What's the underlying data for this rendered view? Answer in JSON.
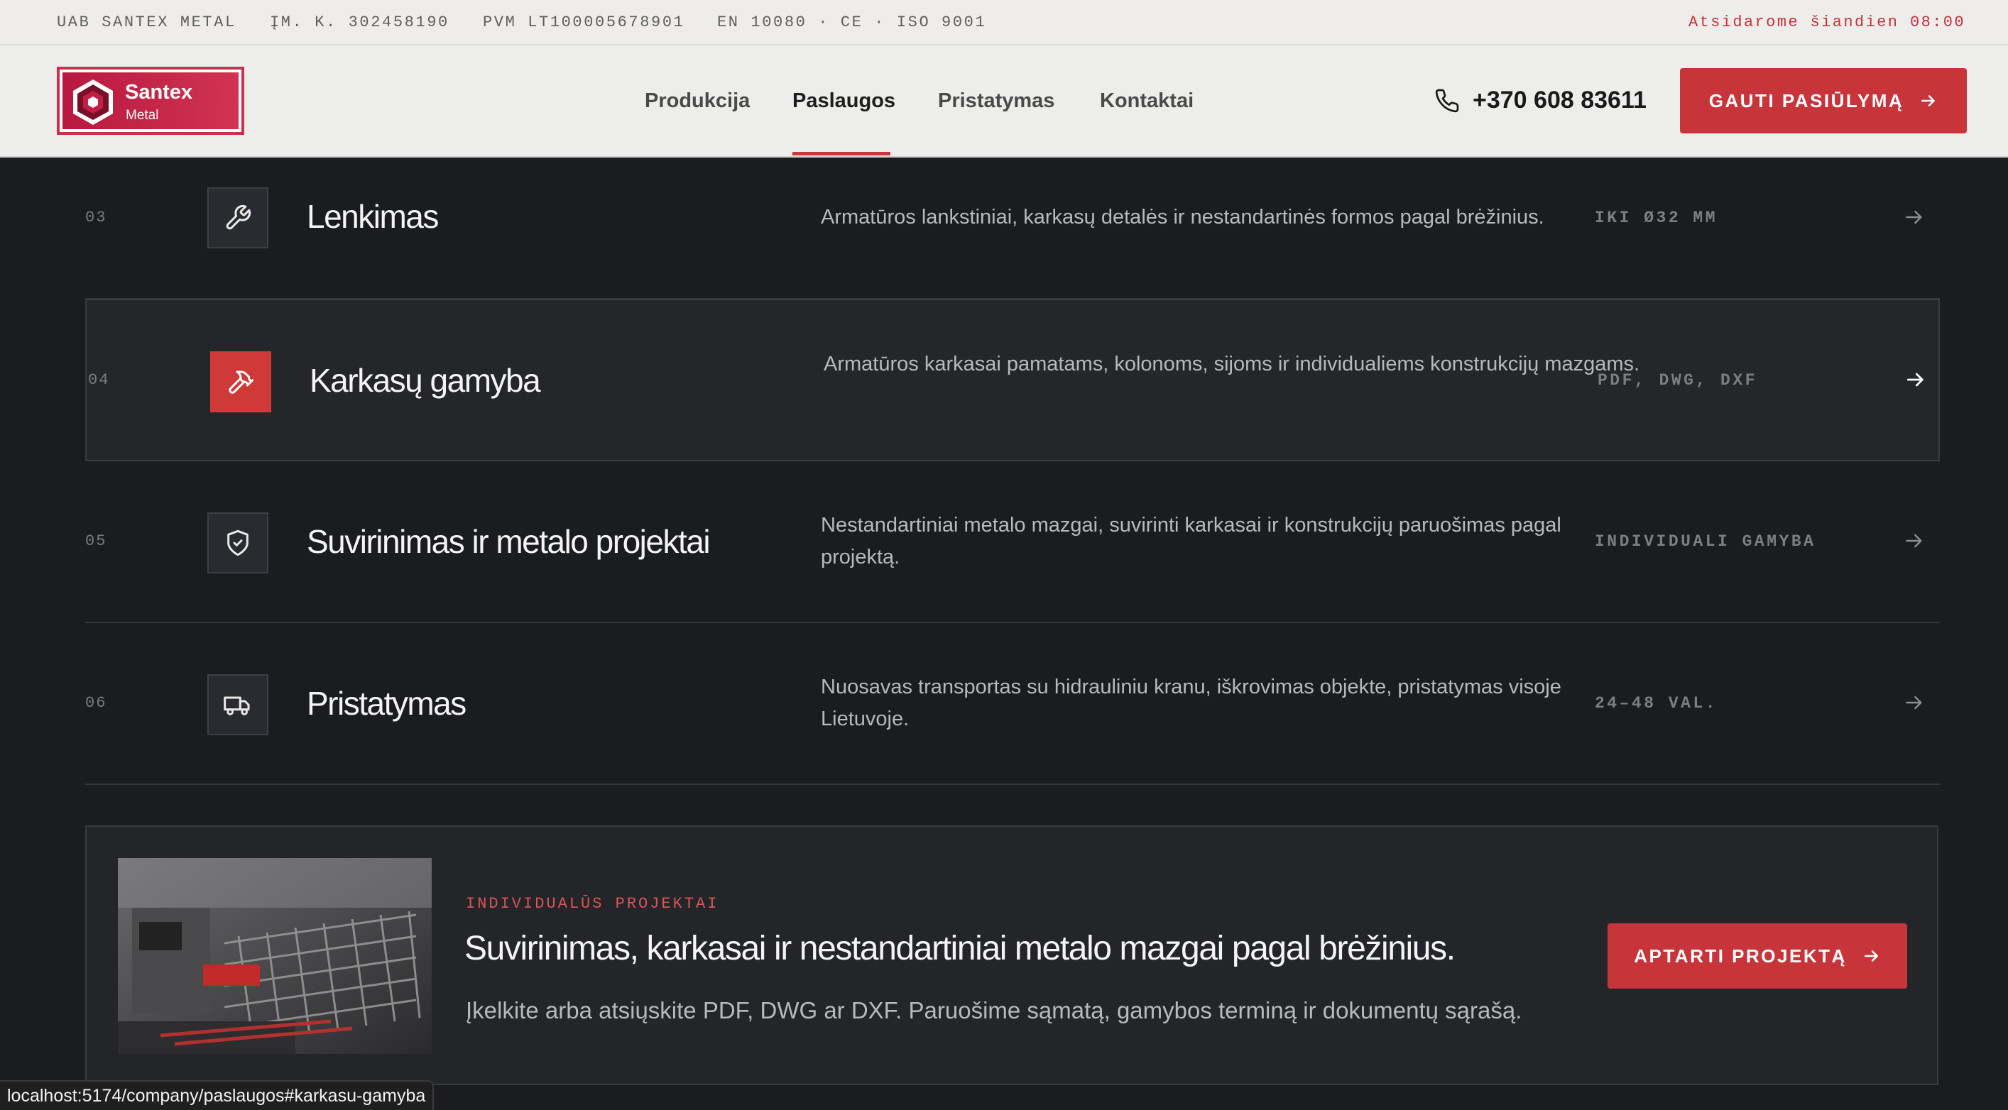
{
  "topbar": {
    "company": "UAB SANTEX METAL",
    "code": "ĮM. K. 302458190",
    "vat": "PVM LT100005678901",
    "standards": "EN 10080 · CE · ISO 9001",
    "open": "Atsidarome šiandien 08:00"
  },
  "logo": {
    "name": "Santex",
    "sub": "Metal"
  },
  "nav": [
    {
      "label": "Produkcija",
      "active": false
    },
    {
      "label": "Paslaugos",
      "active": true
    },
    {
      "label": "Pristatymas",
      "active": false
    },
    {
      "label": "Kontaktai",
      "active": false
    }
  ],
  "phone": "+370 608 83611",
  "cta": "GAUTI PASIŪLYMĄ",
  "accent_color": "#c7343a",
  "services": [
    {
      "num": "03",
      "icon": "wrench-icon",
      "title": "Lenkimas",
      "desc": "Armatūros lankstiniai, karkasų detalės ir nestandartinės formos pagal brėžinius.",
      "tag": "IKI Ø32 MM",
      "highlighted": false
    },
    {
      "num": "04",
      "icon": "hammer-icon",
      "title": "Karkasų gamyba",
      "desc": "Armatūros karkasai pamatams, kolonoms, sijoms ir individualiems konstrukcijų mazgams.",
      "tag": "PDF, DWG, DXF",
      "highlighted": true
    },
    {
      "num": "05",
      "icon": "shield-check-icon",
      "title": "Suvirinimas ir metalo projektai",
      "desc": "Nestandartiniai metalo mazgai, suvirinti karkasai ir konstrukcijų paruošimas pagal projektą.",
      "tag": "INDIVIDUALI GAMYBA",
      "highlighted": false
    },
    {
      "num": "06",
      "icon": "truck-icon",
      "title": "Pristatymas",
      "desc": "Nuosavas transportas su hidrauliniu kranu, iškrovimas objekte, pristatymas visoje Lietuvoje.",
      "tag": "24–48 VAL.",
      "highlighted": false
    }
  ],
  "banner": {
    "eyebrow": "INDIVIDUALŪS PROJEKTAI",
    "title": "Suvirinimas, karkasai ir nestandartiniai metalo mazgai pagal brėžinius.",
    "desc": "Įkelkite arba atsiųskite PDF, DWG ar DXF. Paruošime sąmatą, gamybos terminą ir dokumentų sąrašą.",
    "cta": "APTARTI PROJEKTĄ"
  },
  "status_url": "localhost:5174/company/paslaugos#karkasu-gamyba"
}
